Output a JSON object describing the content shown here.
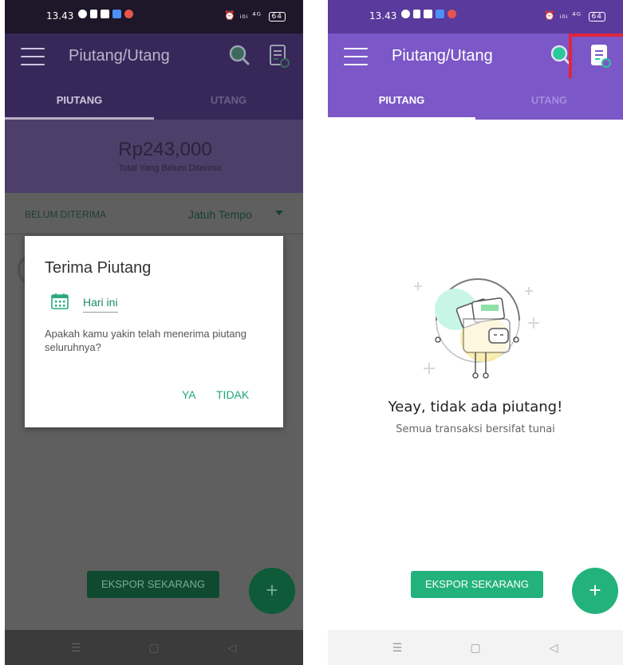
{
  "status_bar": {
    "time": "13.43",
    "right_text": "⏰ ᵢ₀ᵢ ⁴ᴳ",
    "battery": "64"
  },
  "app": {
    "title": "Piutang/Utang",
    "tabs": [
      {
        "label": "PIUTANG",
        "active": true
      },
      {
        "label": "UTANG",
        "active": false
      }
    ],
    "icons": {
      "menu": "hamburger-icon",
      "search": "search-icon",
      "report": "report-icon"
    },
    "accent_color": "#7b57c7",
    "primary_green": "#24b27c"
  },
  "left_screen": {
    "summary": {
      "amount": "Rp243,000",
      "label": "Total Yang Belum Diterima"
    },
    "filter": {
      "left_label": "BELUM DITERIMA",
      "selected": "Jatuh Tempo"
    },
    "dialog": {
      "title": "Terima Piutang",
      "date": "Hari ini",
      "message": "Apakah kamu yakin telah menerima piutang seluruhnya?",
      "yes_label": "YA",
      "no_label": "TIDAK"
    },
    "export_label": "EKSPOR SEKARANG",
    "fab_label": "+"
  },
  "right_screen": {
    "empty": {
      "title": "Yeay, tidak ada piutang!",
      "subtitle": "Semua transaksi bersifat tunai"
    },
    "export_label": "EKSPOR SEKARANG",
    "fab_label": "+",
    "highlight_color": "#e0263c"
  },
  "nav": {
    "menu": "☰",
    "home": "▢",
    "back": "◁"
  }
}
